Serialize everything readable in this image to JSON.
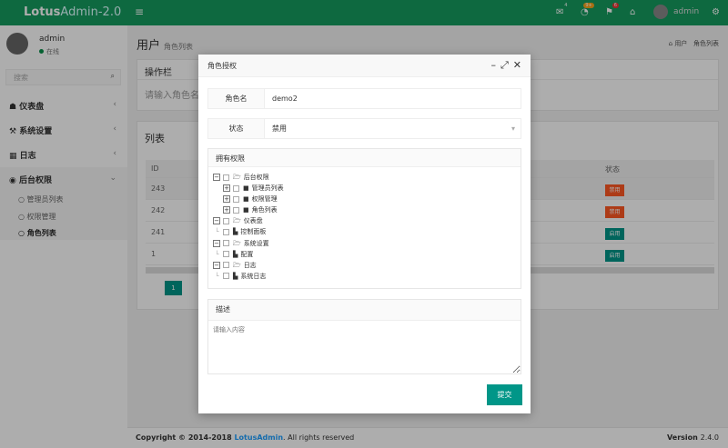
{
  "header": {
    "logo_bold": "Lotus",
    "logo_rest": "Admin-2.0",
    "badges": {
      "mail": "4",
      "bell": "9+",
      "flag": "6"
    },
    "username": "admin"
  },
  "sidebar": {
    "username": "admin",
    "status": "在线",
    "search_placeholder": "搜索",
    "items": [
      {
        "label": "仪表盘",
        "icon": "dashboard-icon"
      },
      {
        "label": "系统设置",
        "icon": "wrench-icon"
      },
      {
        "label": "日志",
        "icon": "calendar-icon"
      },
      {
        "label": "后台权限",
        "icon": "user-circle-icon"
      }
    ],
    "subitems": [
      {
        "label": "管理员列表"
      },
      {
        "label": "权限管理"
      },
      {
        "label": "角色列表",
        "active": true
      }
    ]
  },
  "main": {
    "title": "用户",
    "subtitle": "角色列表",
    "breadcrumb": [
      "用户",
      "角色列表"
    ],
    "toolbar": {
      "title": "操作栏",
      "input_placeholder": "请输入角色名"
    },
    "list": {
      "title": "列表",
      "columns": [
        "ID",
        "状态"
      ],
      "rows": [
        {
          "id": "243",
          "status": "禁用"
        },
        {
          "id": "242",
          "status": "禁用"
        },
        {
          "id": "241",
          "status": "启用"
        },
        {
          "id": "1",
          "status": "启用"
        }
      ],
      "page": "1"
    }
  },
  "colors": {
    "header": "#159b5f",
    "disabled": "#ff5722",
    "enabled": "#009688",
    "primary": "#009688"
  },
  "dialog": {
    "title": "角色授权",
    "role_label": "角色名",
    "role_value": "demo2",
    "status_label": "状态",
    "status_value": "禁用",
    "perm_title": "拥有权限",
    "tree": [
      {
        "label": "后台权限",
        "level": 0,
        "type": "folder-open"
      },
      {
        "label": "管理员列表",
        "level": 1,
        "type": "folder"
      },
      {
        "label": "权限管理",
        "level": 1,
        "type": "folder"
      },
      {
        "label": "角色列表",
        "level": 1,
        "type": "folder"
      },
      {
        "label": "仪表盘",
        "level": 0,
        "type": "folder-open"
      },
      {
        "label": "控制面板",
        "level": 1,
        "type": "file"
      },
      {
        "label": "系统设置",
        "level": 0,
        "type": "folder-open"
      },
      {
        "label": "配置",
        "level": 1,
        "type": "file"
      },
      {
        "label": "日志",
        "level": 0,
        "type": "folder-open"
      },
      {
        "label": "系统日志",
        "level": 1,
        "type": "file"
      }
    ],
    "desc_title": "描述",
    "desc_placeholder": "请输入内容",
    "submit": "提交"
  },
  "footer": {
    "copyright": "Copyright © 2014-2018 ",
    "brand": "LotusAdmin",
    "rights": ". All rights reserved",
    "version_label": "Version",
    "version": "2.4.0"
  }
}
